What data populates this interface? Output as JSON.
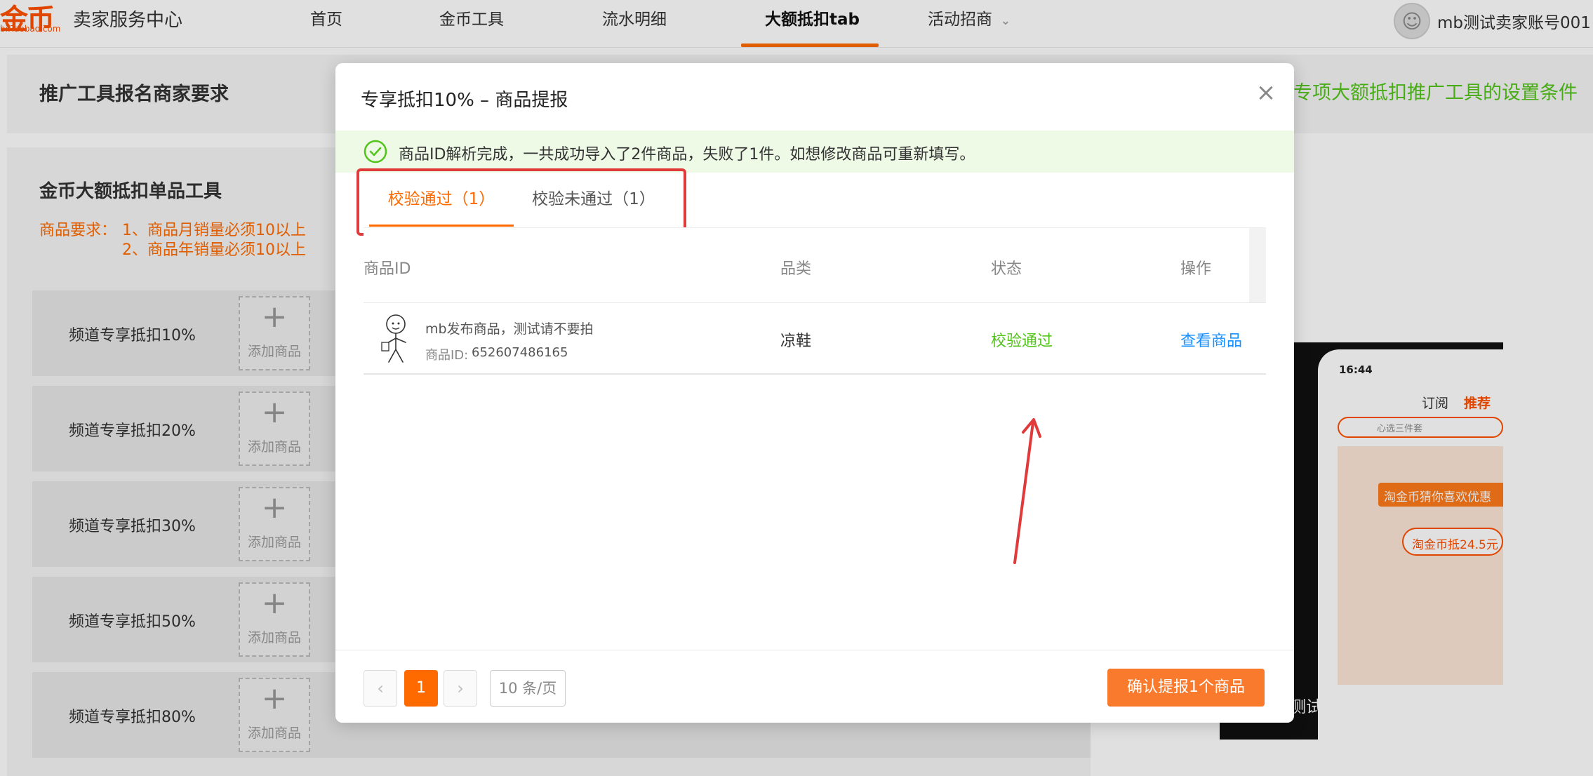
{
  "header": {
    "logo_mark": "金币",
    "logo_sub": "bi.Taobao.com",
    "title": "卖家服务中心",
    "nav": [
      "首页",
      "金币工具",
      "流水明细",
      "大额抵扣tab",
      "活动招商"
    ],
    "dropdown_glyph": "⌄",
    "account_name": "mb测试卖家账号001"
  },
  "panel1": {
    "title": "推广工具报名商家要求",
    "link": "专项大额抵扣推广工具的设置条件"
  },
  "panel2": {
    "title": "金币大额抵扣单品工具",
    "req_label": "商品要求：",
    "req_1": "1、商品月销量必须10以上",
    "req_2": "2、商品年销量必须10以上",
    "slots": [
      {
        "label": "频道专享抵扣10%",
        "add": "添加商品"
      },
      {
        "label": "频道专享抵扣20%",
        "add": "添加商品"
      },
      {
        "label": "频道专享抵扣30%",
        "add": "添加商品"
      },
      {
        "label": "频道专享抵扣50%",
        "add": "添加商品"
      },
      {
        "label": "频道专享抵扣80%",
        "add": "添加商品"
      }
    ]
  },
  "phone": {
    "time": "16:44",
    "tab1": "订阅",
    "tab2": "推荐",
    "search": "心选三件套",
    "banner": "淘金币猜你喜欢优惠",
    "coin": "淘金币抵24.5元",
    "caption": "测试标题需不需要"
  },
  "modal": {
    "title": "专享抵扣10% – 商品提报",
    "close": "×",
    "notice": "商品ID解析完成，一共成功导入了2件商品，失败了1件。如想修改商品可重新填写。",
    "tabs": [
      "校验通过（1）",
      "校验未通过（1）"
    ],
    "columns": [
      "商品ID",
      "品类",
      "状态",
      "操作"
    ],
    "rows": [
      {
        "name": "mb发布商品，测试请不要拍",
        "id_label": "商品ID:",
        "id": "652607486165",
        "category": "凉鞋",
        "status": "校验通过",
        "action": "查看商品"
      }
    ],
    "pagination": {
      "prev": "‹",
      "current": "1",
      "next": "›",
      "page_size": "10 条/页"
    },
    "confirm": "确认提报1个商品"
  },
  "colors": {
    "accent": "#ff6a00",
    "success": "#52c41a",
    "link": "#1890ff",
    "annotation": "#e03a3a"
  }
}
